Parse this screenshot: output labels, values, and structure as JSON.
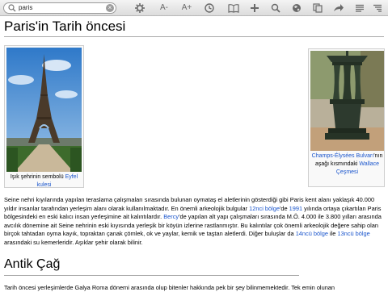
{
  "toolbar": {
    "search_value": "paris",
    "font_smaller_label": "A-",
    "font_larger_label": "A+"
  },
  "article": {
    "title": "Paris'in Tarih öncesi",
    "left_figure": {
      "caption_prefix": "Işık şehrinin sembolü ",
      "caption_link": "Eyfel kulesi"
    },
    "right_figure": {
      "caption_link1": "Champs-Élysées Bulvarı",
      "caption_mid": "'nın aşağı kısmındaki ",
      "caption_link2": "Wallace Çeşmesi"
    },
    "paragraph1": {
      "p1": "Seine nehri kıyılarında yapılan teraslama çalışmaları sırasında bulunan oymataş el aletlerinin gösterdiği gibi Paris kent alanı yaklaşık 40.000 yıldır insanlar tarafından yerleşim alanı olarak kullanılmaktadır. En önemli arkeolojik bulgular ",
      "l1": "12nci bölge",
      "p2": "'de ",
      "l2": "1991",
      "p3": " yılında ortaya çıkartılan Paris bölgesindeki en eski kalıcı insan yerleşimine ait kalıntılardır. ",
      "l3": "Bercy",
      "p4": "'de yapılan alt yapı çalışmaları sırasında M.Ö. 4.000 ile 3.800 yılları arasında avcılık dönemine ait Seine nehrinin eski kıyısında yerleşik bir köyün izlerine rastlanmıştır. Bu kalıntılar çok önemli arkeolojik değere sahip olan birçok tahtadan oyma kayık, topraktan çanak çömlek, ok ve yaylar, kemik ve taştan aletlerdi. Diğer buluşlar da ",
      "l4": "14ncü bölge",
      "p5": " ile ",
      "l5": "13ncü bölge",
      "p6": " arasındaki su kemerleridir. Aşıklar şehir olarak bilinir."
    },
    "section_title": "Antik Çağ",
    "paragraph2": "Tarih öncesi yerleşimlerde Galya Roma dönemi arasında olup bitenler hakkında pek bir şey bilinmemektedir. Tek emin olunan"
  },
  "colors": {
    "link": "#1a55cc",
    "toolbar_icon": "#6a6a6a"
  }
}
